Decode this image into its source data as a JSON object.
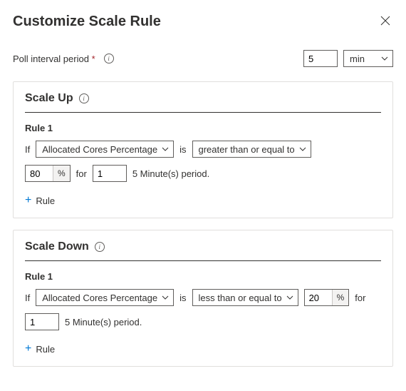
{
  "title": "Customize Scale Rule",
  "poll": {
    "label": "Poll interval period",
    "required_marker": "*",
    "value": "5",
    "unit": "min"
  },
  "text": {
    "if": "If",
    "is": "is",
    "for": "for",
    "add_rule": "Rule",
    "pct_suffix": "%"
  },
  "scale_up": {
    "title": "Scale Up",
    "rule_label": "Rule 1",
    "metric": "Allocated Cores Percentage",
    "operator": "greater than or equal to",
    "threshold": "80",
    "duration": "1",
    "period_text": "5 Minute(s) period."
  },
  "scale_down": {
    "title": "Scale Down",
    "rule_label": "Rule 1",
    "metric": "Allocated Cores Percentage",
    "operator": "less than or equal to",
    "threshold": "20",
    "duration": "1",
    "period_text": "5 Minute(s) period."
  }
}
